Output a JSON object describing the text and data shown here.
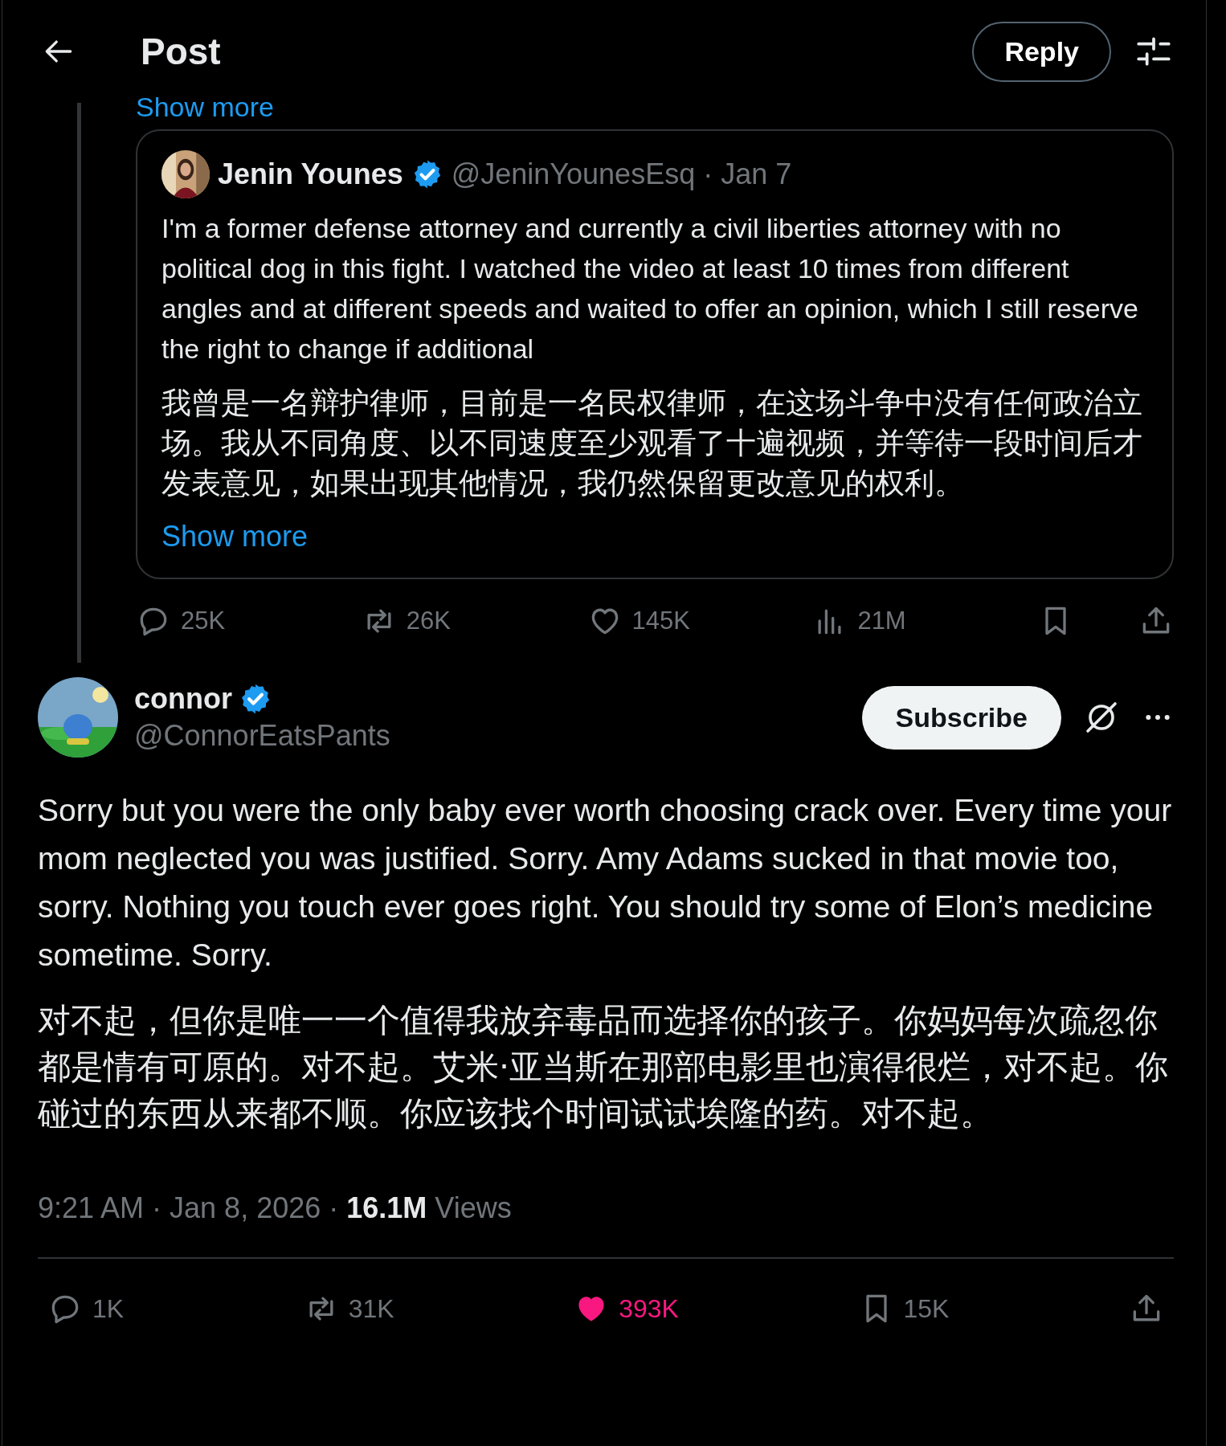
{
  "header": {
    "title": "Post",
    "reply_button": "Reply"
  },
  "quoted_post": {
    "cut_link": "Show more",
    "author": {
      "name": "Jenin Younes",
      "verified": true,
      "handle": "@JeninYounesEsq",
      "dot": "·",
      "date": "Jan 7"
    },
    "text": "I'm a former defense attorney and currently a civil liberties attorney with no political dog in this fight. I watched the video at least 10 times from different angles and at different speeds and waited to offer an opinion, which I still reserve the right to change if additional",
    "translation": "我曾是一名辩护律师，目前是一名民权律师，在这场斗争中没有任何政治立场。我从不同角度、以不同速度至少观看了十遍视频，并等待一段时间后才发表意见，如果出现其他情况，我仍然保留更改意见的权利。",
    "show_more": "Show more",
    "actions": [
      {
        "kind": "reply",
        "count": "25K"
      },
      {
        "kind": "repost",
        "count": "26K"
      },
      {
        "kind": "like",
        "count": "145K",
        "selected": false
      },
      {
        "kind": "views",
        "count": "21M"
      },
      {
        "kind": "bookmark"
      },
      {
        "kind": "share"
      }
    ]
  },
  "post": {
    "author": {
      "name": "connor",
      "verified": true,
      "handle": "@ConnorEatsPants"
    },
    "subscribe_button": "Subscribe",
    "text": "Sorry but you were the only baby ever worth choosing crack over. Every time your mom neglected you was justified. Sorry. Amy Adams sucked in that movie too, sorry. Nothing you touch ever goes right. You should try some of Elon’s medicine sometime. Sorry.",
    "translation": "对不起，但你是唯一一个值得我放弃毒品而选择你的孩子。你妈妈每次疏忽你都是情有可原的。对不起。艾米·亚当斯在那部电影里也演得很烂，对不起。你碰过的东西从来都不顺。你应该找个时间试试埃隆的药。对不起。",
    "meta": "9:21 AM · Jan 8, 2026 · **16.1M** Views",
    "actions": [
      {
        "kind": "reply",
        "count": "1K"
      },
      {
        "kind": "repost",
        "count": "31K"
      },
      {
        "kind": "like",
        "count": "393K",
        "selected": true
      },
      {
        "kind": "bookmark",
        "count": "15K"
      },
      {
        "kind": "share"
      }
    ]
  }
}
